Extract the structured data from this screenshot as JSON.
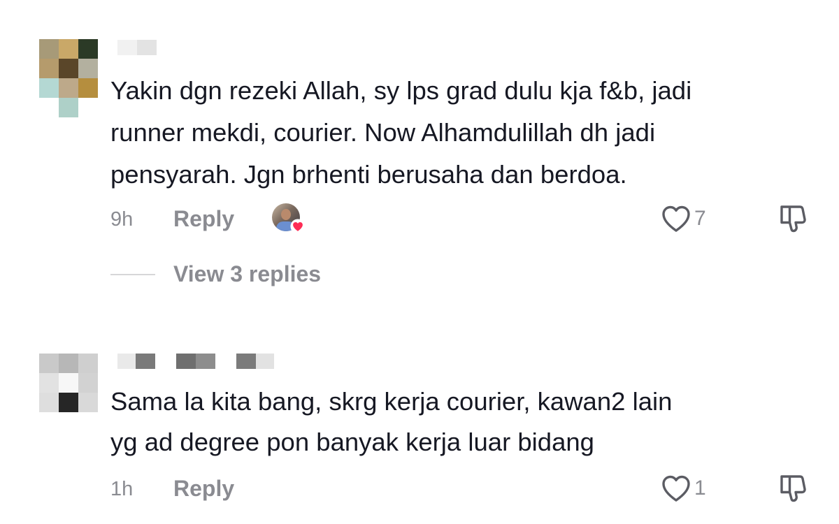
{
  "comments": [
    {
      "text_lines": [
        "Yakin dgn rezeki Allah, sy lps grad dulu kja f&b, jadi",
        "runner mekdi, courier. Now Alhamdulillah dh jadi",
        "pensyarah. Jgn brhenti berusaha dan berdoa."
      ],
      "time": "9h",
      "reply_label": "Reply",
      "like_count": "7",
      "view_replies_label": "View 3 replies"
    },
    {
      "text_lines": [
        "Sama la kita bang, skrg kerja courier, kawan2 lain",
        "yg ad degree pon banyak kerja luar bidang"
      ],
      "time": "1h",
      "reply_label": "Reply",
      "like_count": "1"
    }
  ],
  "colors": {
    "text": "#161823",
    "muted": "#8a8b91",
    "heart_red": "#fe2c55"
  }
}
